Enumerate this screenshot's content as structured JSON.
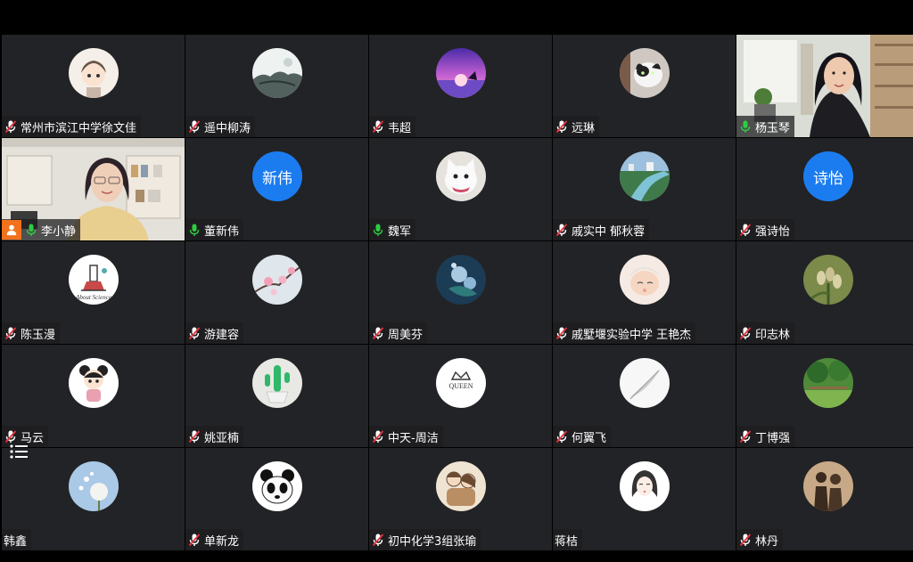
{
  "participants": [
    {
      "name": "常州市滨江中学徐文佳",
      "mic": "muted",
      "avatar": "cartoon-girl-icon"
    },
    {
      "name": "遥中柳涛",
      "mic": "muted",
      "avatar": "ink-landscape-icon"
    },
    {
      "name": "韦超",
      "mic": "muted",
      "avatar": "purple-sunset-icon"
    },
    {
      "name": "远琳",
      "mic": "muted",
      "avatar": "cat-photo-icon"
    },
    {
      "name": "杨玉琴",
      "mic": "on",
      "avatar": "video"
    },
    {
      "name": "李小静",
      "mic": "on",
      "avatar": "video",
      "host": true
    },
    {
      "name": "董新伟",
      "mic": "on",
      "avatar_text": "新伟"
    },
    {
      "name": "魏军",
      "mic": "on",
      "avatar": "white-cat-icon"
    },
    {
      "name": "戚实中 郁秋蓉",
      "mic": "muted",
      "avatar": "river-city-icon"
    },
    {
      "name": "强诗怡",
      "mic": "muted",
      "avatar_text": "诗怡"
    },
    {
      "name": "陈玉漫",
      "mic": "muted",
      "avatar": "about-science-icon"
    },
    {
      "name": "游建容",
      "mic": "muted",
      "avatar": "plum-blossom-icon"
    },
    {
      "name": "周美芬",
      "mic": "muted",
      "avatar": "blue-flower-icon"
    },
    {
      "name": "戚墅堰实验中学 王艳杰",
      "mic": "muted",
      "avatar": "baby-photo-icon"
    },
    {
      "name": "印志林",
      "mic": "muted",
      "avatar": "plant-buds-icon"
    },
    {
      "name": "马云",
      "mic": "muted",
      "avatar": "cartoon-child-icon"
    },
    {
      "name": "姚亚楠",
      "mic": "muted",
      "avatar": "cactus-icon"
    },
    {
      "name": "中天-周洁",
      "mic": "muted",
      "avatar": "queen-crown-icon"
    },
    {
      "name": "何翼飞",
      "mic": "muted",
      "avatar": "feather-icon"
    },
    {
      "name": "丁博强",
      "mic": "muted",
      "avatar": "green-park-icon"
    },
    {
      "name": "韩鑫",
      "mic": "none",
      "avatar": "dandelion-icon"
    },
    {
      "name": "单新龙",
      "mic": "muted",
      "avatar": "panda-icon"
    },
    {
      "name": "初中化学3组张瑜",
      "mic": "muted",
      "avatar": "couple-sketch-icon"
    },
    {
      "name": "蒋桔",
      "mic": "none",
      "avatar": "girl-sketch-icon"
    },
    {
      "name": "林丹",
      "mic": "muted",
      "avatar": "silhouette-icon"
    }
  ],
  "avatar_color": "#1b7cf0",
  "mic_on_color": "#2ecc40",
  "mic_muted_color": "#e8323c"
}
